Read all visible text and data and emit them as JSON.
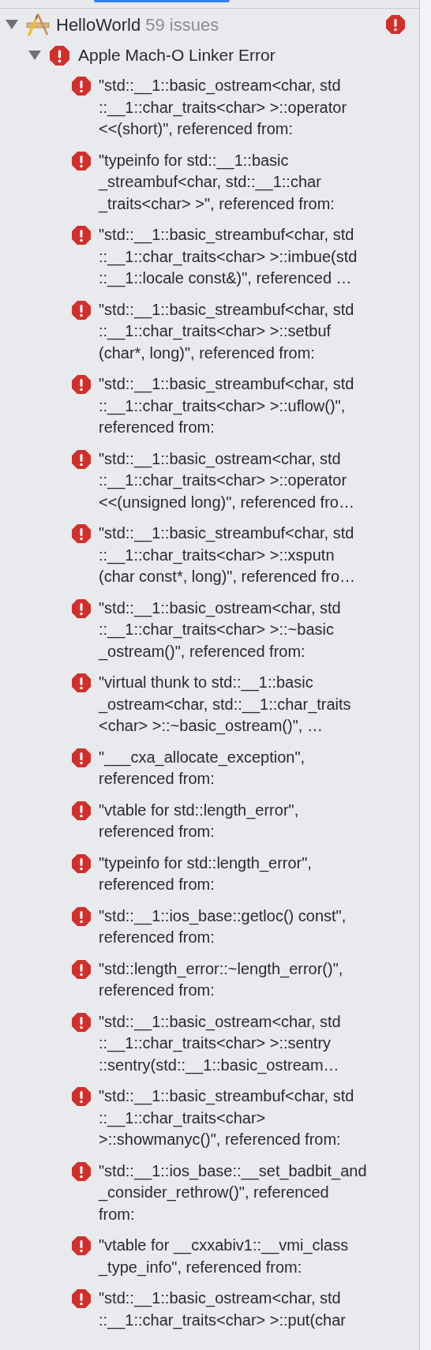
{
  "project": {
    "name": "HelloWorld",
    "issue_count": "59 issues",
    "expanded": true
  },
  "group": {
    "title": "Apple Mach-O Linker Error",
    "expanded": true,
    "issues": [
      {
        "lines": [
          "\"std::__1::basic_ostream<char, std",
          "::__1::char_traits<char> >::operator",
          "<<(short)\", referenced from:"
        ]
      },
      {
        "lines": [
          "\"typeinfo for std::__1::basic",
          "_streambuf<char, std::__1::char",
          "_traits<char> >\", referenced from:"
        ]
      },
      {
        "lines": [
          "\"std::__1::basic_streambuf<char, std",
          "::__1::char_traits<char> >::imbue(std",
          "::__1::locale const&)\", referenced …"
        ]
      },
      {
        "lines": [
          "\"std::__1::basic_streambuf<char, std",
          "::__1::char_traits<char> >::setbuf",
          "(char*, long)\", referenced from:"
        ]
      },
      {
        "lines": [
          "\"std::__1::basic_streambuf<char, std",
          "::__1::char_traits<char> >::uflow()\",",
          "referenced from:"
        ]
      },
      {
        "lines": [
          "\"std::__1::basic_ostream<char, std",
          "::__1::char_traits<char> >::operator",
          "<<(unsigned long)\", referenced fro…"
        ]
      },
      {
        "lines": [
          "\"std::__1::basic_streambuf<char, std",
          "::__1::char_traits<char> >::xsputn",
          "(char const*, long)\", referenced fro…"
        ]
      },
      {
        "lines": [
          "\"std::__1::basic_ostream<char, std",
          "::__1::char_traits<char> >::~basic",
          "_ostream()\", referenced from:"
        ]
      },
      {
        "lines": [
          "\"virtual thunk to std::__1::basic",
          "_ostream<char, std::__1::char_traits",
          "<char> >::~basic_ostream()\", …"
        ]
      },
      {
        "lines": [
          "\"___cxa_allocate_exception\",",
          "referenced from:"
        ]
      },
      {
        "lines": [
          "\"vtable for std::length_error\",",
          "referenced from:"
        ]
      },
      {
        "lines": [
          "\"typeinfo for std::length_error\",",
          "referenced from:"
        ]
      },
      {
        "lines": [
          "\"std::__1::ios_base::getloc() const\",",
          "referenced from:"
        ]
      },
      {
        "lines": [
          "\"std::length_error::~length_error()\",",
          "referenced from:"
        ]
      },
      {
        "lines": [
          "\"std::__1::basic_ostream<char, std",
          "::__1::char_traits<char> >::sentry",
          "::sentry(std::__1::basic_ostream…"
        ]
      },
      {
        "lines": [
          "\"std::__1::basic_streambuf<char, std",
          "::__1::char_traits<char>",
          ">::showmanyc()\", referenced from:"
        ]
      },
      {
        "lines": [
          "\"std::__1::ios_base::__set_badbit_and",
          "_consider_rethrow()\", referenced",
          "from:"
        ]
      },
      {
        "lines": [
          "\"vtable for __cxxabiv1::__vmi_class",
          "_type_info\", referenced from:"
        ]
      },
      {
        "lines": [
          "\"std::__1::basic_ostream<char, std",
          "::__1::char_traits<char> >::put(char"
        ]
      }
    ]
  }
}
